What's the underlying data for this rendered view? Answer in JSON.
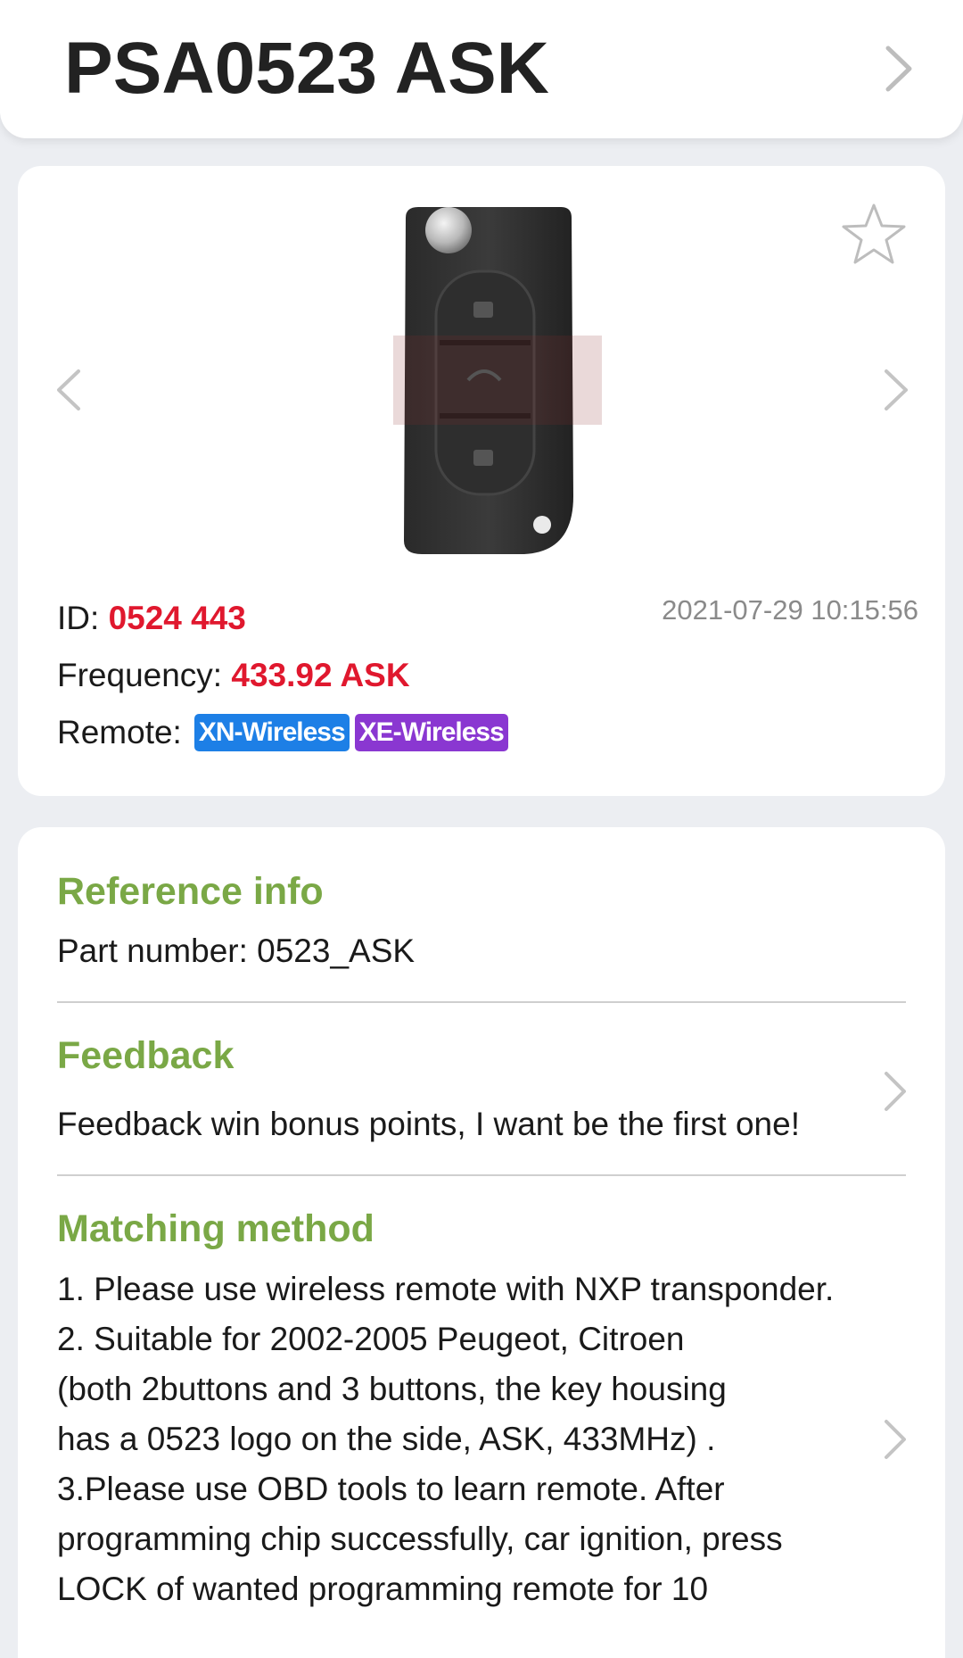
{
  "header": {
    "title": "PSA0523 ASK"
  },
  "product": {
    "id_label": "ID: ",
    "id_value": "0524 443",
    "frequency_label": "Frequency: ",
    "frequency_value": "433.92 ASK",
    "remote_label": "Remote: ",
    "remote_badges": [
      {
        "label": "XN-Wireless",
        "color": "#1d7fe6"
      },
      {
        "label": "XE-Wireless",
        "color": "#8a37d1"
      }
    ],
    "timestamp": "2021-07-29 10:15:56"
  },
  "reference": {
    "title": "Reference info",
    "text": "Part number: 0523_ASK"
  },
  "feedback": {
    "title": "Feedback",
    "text": "Feedback win bonus points, I want be the first one!"
  },
  "matching": {
    "title": "Matching method",
    "lines": [
      "1. Please use wireless remote with NXP transponder.",
      "2. Suitable for 2002-2005 Peugeot, Citroen",
      "(both 2buttons and 3 buttons, the key housing",
      "has a 0523 logo on the side, ASK, 433MHz) .",
      "3.Please use OBD tools to learn remote. After",
      "programming chip successfully, car ignition, press",
      "LOCK of wanted programming remote for 10"
    ]
  },
  "colors": {
    "accent_green": "#7aa846",
    "value_red": "#e0182e",
    "background": "#eceef2"
  },
  "icons": [
    "chevron-right-icon",
    "star-outline-icon",
    "chevron-left-icon"
  ]
}
